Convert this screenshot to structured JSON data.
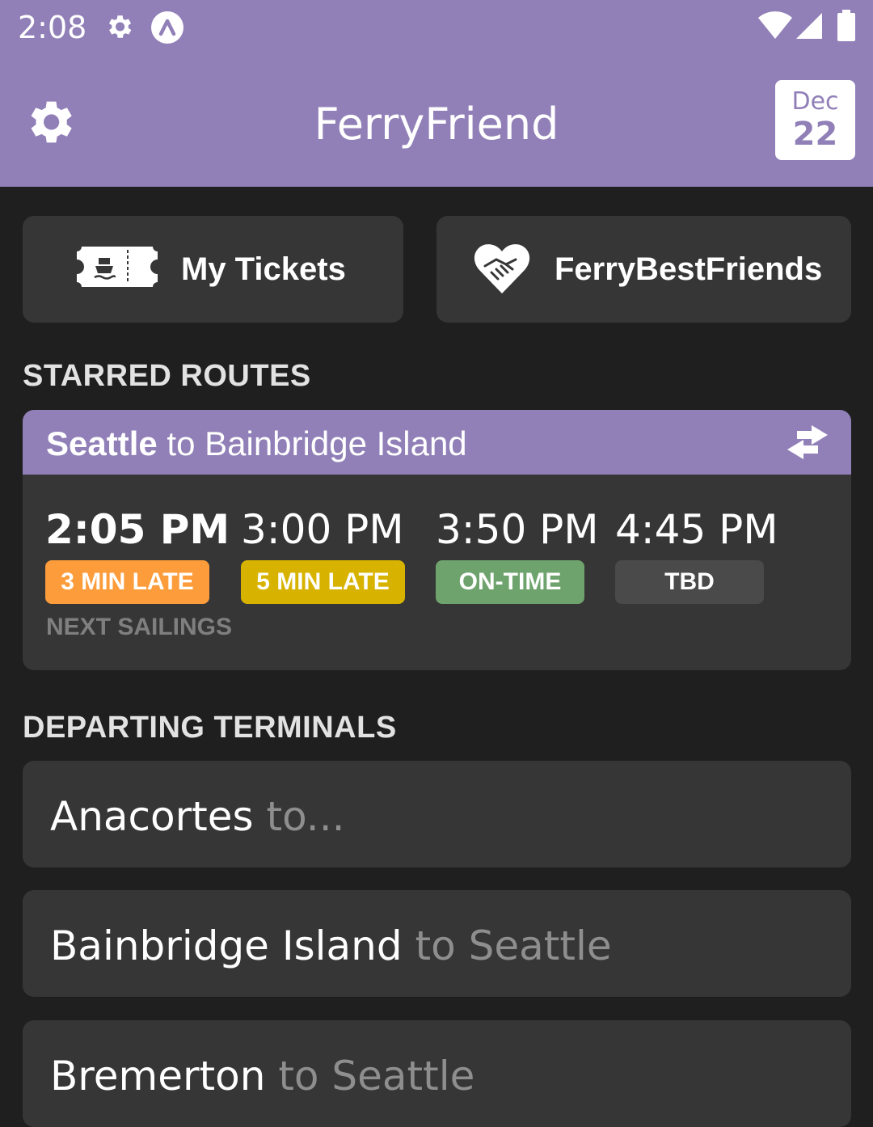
{
  "status_bar": {
    "time": "2:08",
    "icons": [
      "gear-icon",
      "app-notification-icon",
      "wifi-icon",
      "signal-icon",
      "battery-icon"
    ]
  },
  "header": {
    "title": "FerryFriend",
    "settings_icon": "gear-icon",
    "date_badge": {
      "month": "Dec",
      "day": "22"
    }
  },
  "actions": {
    "tickets": {
      "label": "My Tickets",
      "icon": "ticket-icon"
    },
    "friends": {
      "label": "FerryBestFriends",
      "icon": "handshake-heart-icon"
    }
  },
  "starred": {
    "heading": "STARRED ROUTES",
    "route": {
      "from": "Seattle",
      "connector": " to ",
      "to": "Bainbridge Island",
      "swap_icon": "swap-arrows-icon",
      "sailings": [
        {
          "time": "2:05 PM",
          "status": "3 MIN LATE",
          "color": "#fd9c3a"
        },
        {
          "time": "3:00 PM",
          "status": "5 MIN LATE",
          "color": "#d7b300"
        },
        {
          "time": "3:50 PM",
          "status": "ON-TIME",
          "color": "#6fa36e"
        },
        {
          "time": "4:45 PM",
          "status": "TBD",
          "color": "#4a4a4a"
        }
      ],
      "next_label": "NEXT SAILINGS"
    }
  },
  "departing": {
    "heading": "DEPARTING TERMINALS",
    "terminals": [
      {
        "name": "Anacortes",
        "dest": " to..."
      },
      {
        "name": "Bainbridge Island",
        "dest": " to Seattle"
      },
      {
        "name": "Bremerton",
        "dest": " to Seattle"
      }
    ]
  },
  "colors": {
    "brand": "#9180b8",
    "background": "#1f1f1f",
    "card": "#363636"
  }
}
